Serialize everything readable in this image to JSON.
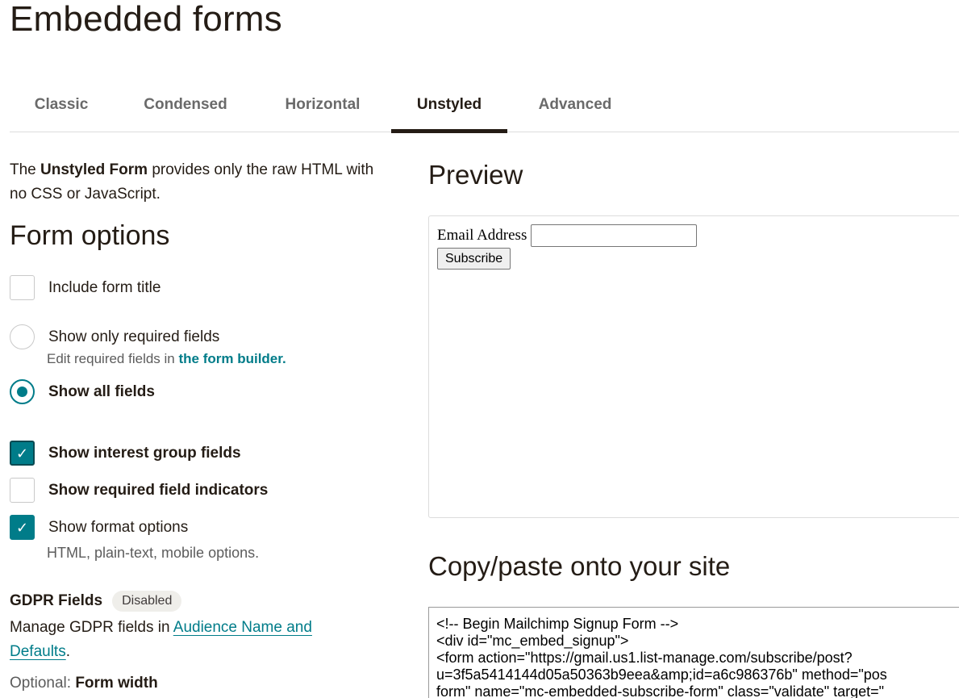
{
  "page": {
    "title": "Embedded forms"
  },
  "tabs": [
    {
      "label": "Classic",
      "active": false
    },
    {
      "label": "Condensed",
      "active": false
    },
    {
      "label": "Horizontal",
      "active": false
    },
    {
      "label": "Unstyled",
      "active": true
    },
    {
      "label": "Advanced",
      "active": false
    }
  ],
  "intro": {
    "prefix": "The ",
    "bold": "Unstyled Form",
    "suffix": " provides only the raw HTML with no CSS or JavaScript."
  },
  "form_options": {
    "title": "Form options",
    "include_title": {
      "label": "Include form title",
      "checked": false
    },
    "required_only": {
      "label": "Show only required fields",
      "selected": false
    },
    "required_hint_prefix": "Edit required fields in ",
    "required_hint_link": "the form builder.",
    "all_fields": {
      "label": "Show all fields",
      "selected": true
    },
    "interest_groups": {
      "label": "Show interest group fields",
      "checked": true
    },
    "required_indicators": {
      "label": "Show required field indicators",
      "checked": false
    },
    "format_options": {
      "label": "Show format options",
      "checked": true
    },
    "format_hint": "HTML, plain-text, mobile options."
  },
  "gdpr": {
    "title": "GDPR Fields",
    "badge": "Disabled",
    "text_prefix": "Manage GDPR fields in ",
    "link": "Audience Name and Defaults",
    "text_suffix": "."
  },
  "optional": {
    "prefix": "Optional: ",
    "bold": "Form width"
  },
  "preview": {
    "title": "Preview",
    "email_label": "Email Address",
    "email_value": "",
    "button": "Subscribe"
  },
  "copy": {
    "title": "Copy/paste onto your site",
    "lines": [
      "<!-- Begin Mailchimp Signup Form -->",
      "<div id=\"mc_embed_signup\">",
      "<form action=\"https://gmail.us1.list-manage.com/subscribe/post?",
      "u=3f5a5414144d05a50363b9eea&amp;id=a6c986376b\" method=\"pos",
      "form\" name=\"mc-embedded-subscribe-form\" class=\"validate\" target=\""
    ]
  },
  "colors": {
    "accent": "#007c89",
    "text": "#241c15",
    "muted": "#5c5c5c",
    "badge_bg": "#efeeea"
  }
}
